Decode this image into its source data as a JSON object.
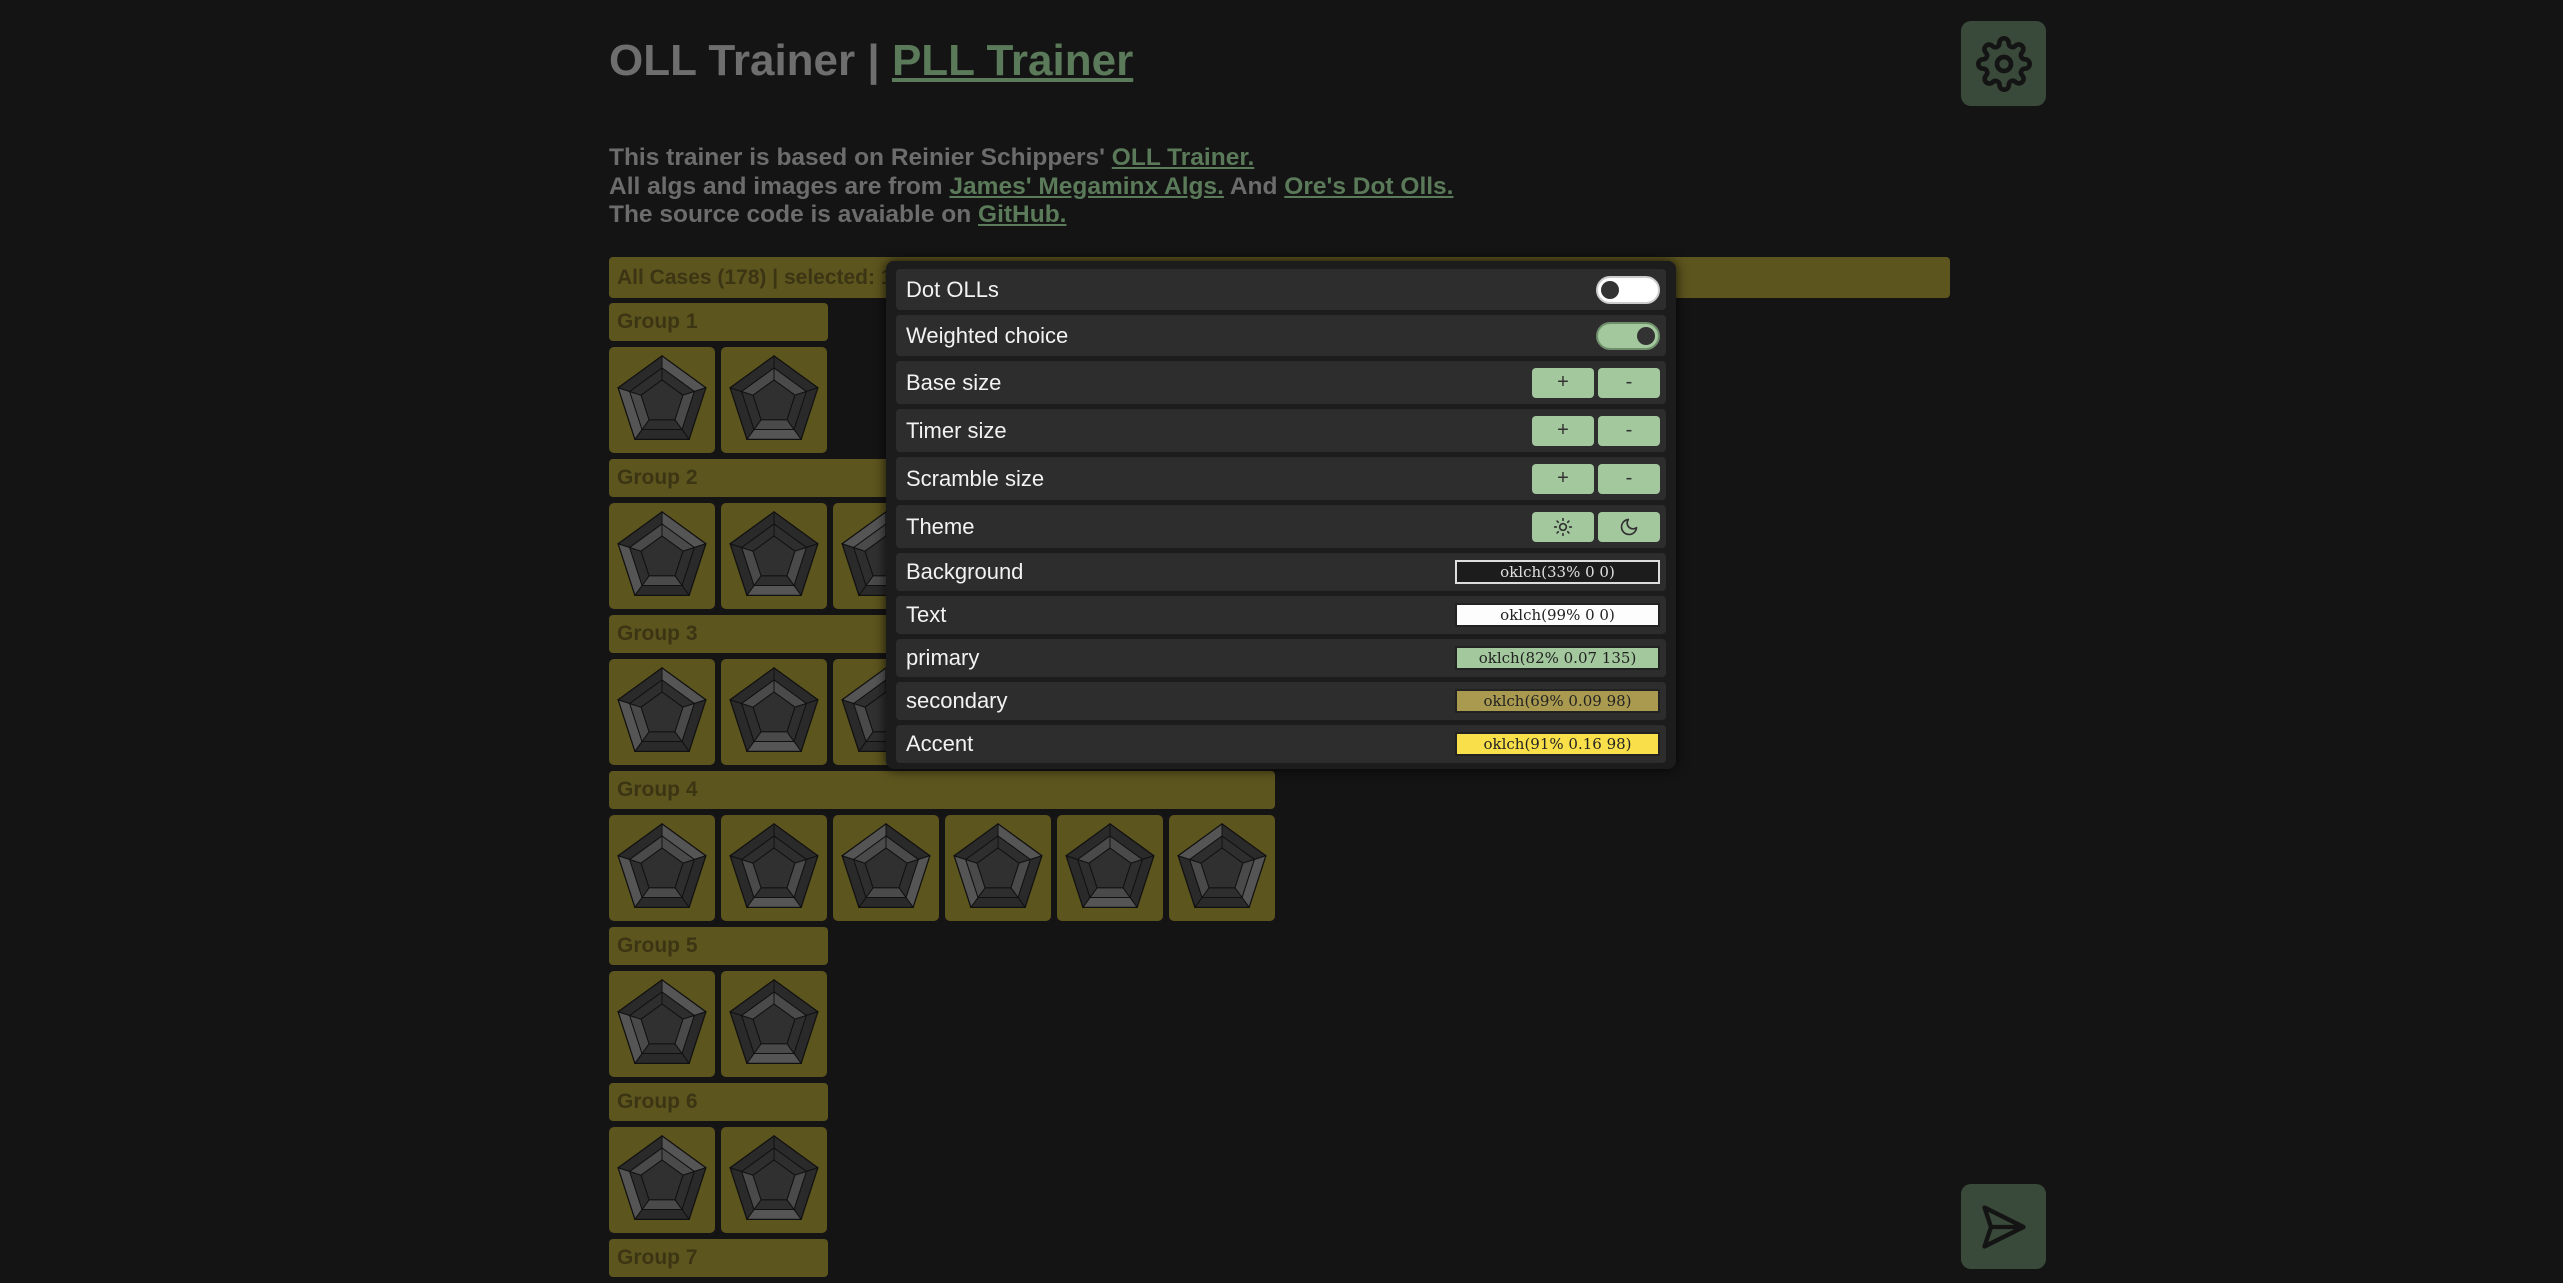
{
  "header": {
    "title_oll": "OLL Trainer",
    "separator": "|",
    "title_pll_link": "PLL Trainer"
  },
  "intro": {
    "line1_text": "This trainer is based on Reinier Schippers'",
    "line1_link": "OLL Trainer.",
    "line2_text": "All algs and images are from",
    "line2_link1": "James' Megaminx Algs.",
    "line2_mid": "And",
    "line2_link2": "Ore's Dot Olls.",
    "line3_text": "The source code is avaiable on",
    "line3_link": "GitHub."
  },
  "icons": {
    "settings": "gear-icon",
    "send": "send-icon",
    "theme_light": "sun-icon",
    "theme_dark": "moon-icon"
  },
  "cases_bar": {
    "label": "All Cases (178) | selected: 1"
  },
  "groups": [
    {
      "label": "Group 1",
      "count": 2
    },
    {
      "label": "Group 2",
      "count": 3
    },
    {
      "label": "Group 3",
      "count": 3
    },
    {
      "label": "Group 4",
      "count": 6
    },
    {
      "label": "Group 5",
      "count": 2
    },
    {
      "label": "Group 6",
      "count": 2
    },
    {
      "label": "Group 7",
      "count": 0
    }
  ],
  "settings": {
    "dot_olls": {
      "label": "Dot OLLs",
      "enabled": false
    },
    "weighted_choice": {
      "label": "Weighted choice",
      "enabled": true
    },
    "base_size": {
      "label": "Base size",
      "plus": "+",
      "minus": "-"
    },
    "timer_size": {
      "label": "Timer size",
      "plus": "+",
      "minus": "-"
    },
    "scramble_size": {
      "label": "Scramble size",
      "plus": "+",
      "minus": "-"
    },
    "theme": {
      "label": "Theme"
    },
    "background": {
      "label": "Background",
      "value": "oklch(33% 0 0)",
      "swatch": "#1c1c1c",
      "text_color": "#e0e0e0"
    },
    "text": {
      "label": "Text",
      "value": "oklch(99% 0 0)",
      "swatch": "#fdfdfd",
      "text_color": "#222222"
    },
    "primary": {
      "label": "primary",
      "value": "oklch(82% 0.07 135)",
      "swatch": "#a3c89e",
      "text_color": "#222222"
    },
    "secondary": {
      "label": "secondary",
      "value": "oklch(69% 0.09 98)",
      "swatch": "#a99a4f",
      "text_color": "#222222"
    },
    "accent": {
      "label": "Accent",
      "value": "oklch(91% 0.16 98)",
      "swatch": "#f9e04b",
      "text_color": "#222222"
    }
  },
  "colors": {
    "page_bg": "#141414",
    "secondary_dim": "#5d551e",
    "primary_dim": "#3a4a3a",
    "link": "#5a7a59"
  }
}
